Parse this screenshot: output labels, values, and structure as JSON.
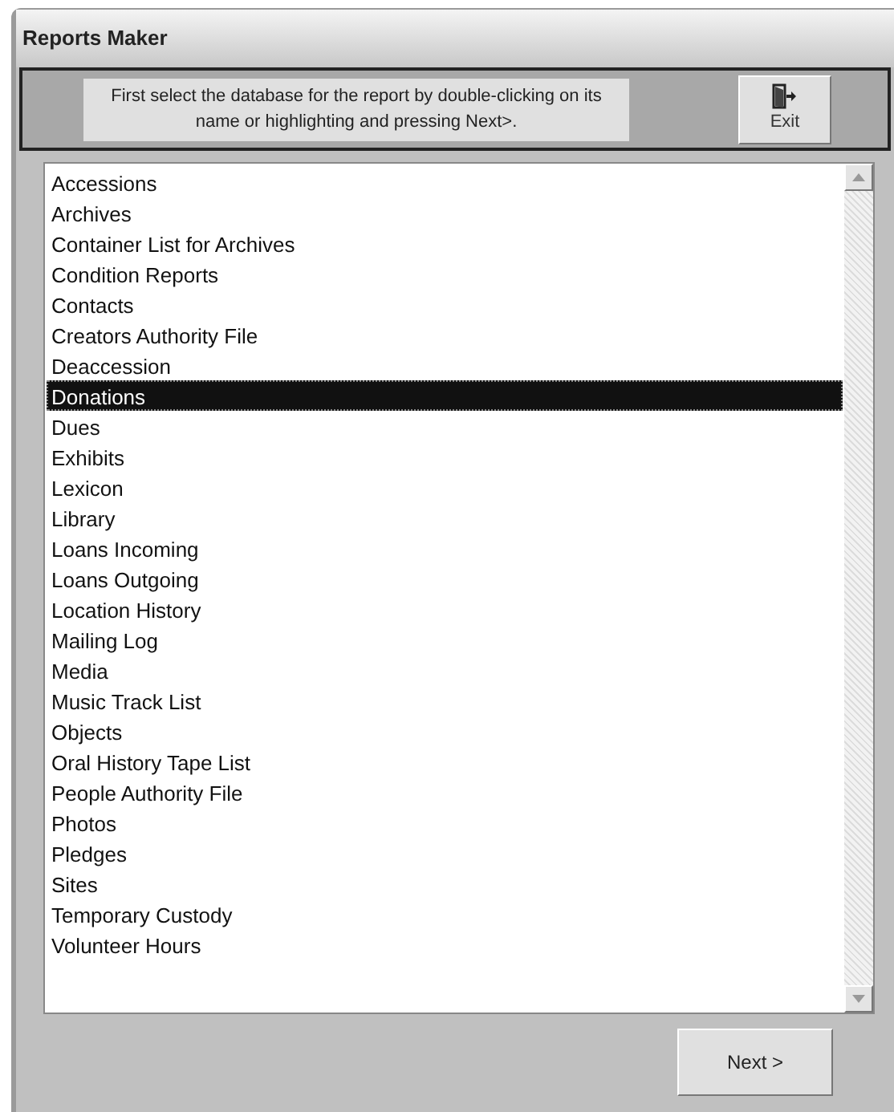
{
  "window": {
    "title": "Reports Maker"
  },
  "instructions": "First select the database for the report by double-clicking on its name or highlighting and pressing Next>.",
  "exit_button": {
    "label": "Exit"
  },
  "databases": [
    {
      "label": "Accessions",
      "selected": false
    },
    {
      "label": "Archives",
      "selected": false
    },
    {
      "label": "Container List for Archives",
      "selected": false
    },
    {
      "label": "Condition Reports",
      "selected": false
    },
    {
      "label": "Contacts",
      "selected": false
    },
    {
      "label": "Creators Authority File",
      "selected": false
    },
    {
      "label": "Deaccession",
      "selected": false
    },
    {
      "label": "Donations",
      "selected": true
    },
    {
      "label": "Dues",
      "selected": false
    },
    {
      "label": "Exhibits",
      "selected": false
    },
    {
      "label": "Lexicon",
      "selected": false
    },
    {
      "label": "Library",
      "selected": false
    },
    {
      "label": "Loans Incoming",
      "selected": false
    },
    {
      "label": "Loans Outgoing",
      "selected": false
    },
    {
      "label": "Location History",
      "selected": false
    },
    {
      "label": "Mailing Log",
      "selected": false
    },
    {
      "label": "Media",
      "selected": false
    },
    {
      "label": "Music Track List",
      "selected": false
    },
    {
      "label": "Objects",
      "selected": false
    },
    {
      "label": "Oral History Tape List",
      "selected": false
    },
    {
      "label": "People Authority File",
      "selected": false
    },
    {
      "label": "Photos",
      "selected": false
    },
    {
      "label": "Pledges",
      "selected": false
    },
    {
      "label": "Sites",
      "selected": false
    },
    {
      "label": "Temporary Custody",
      "selected": false
    },
    {
      "label": "Volunteer Hours",
      "selected": false
    }
  ],
  "next_button": {
    "label": "Next >"
  }
}
